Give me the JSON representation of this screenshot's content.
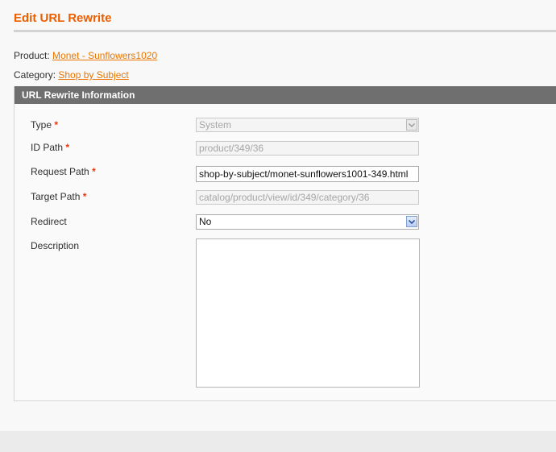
{
  "page": {
    "title": "Edit URL Rewrite"
  },
  "meta": {
    "product_label": "Product:",
    "product_link": "Monet - Sunflowers1020",
    "category_label": "Category:",
    "category_link": "Shop by Subject"
  },
  "fieldset": {
    "title": "URL Rewrite Information",
    "required_marker": "*",
    "fields": {
      "type": {
        "label": "Type",
        "value": "System",
        "disabled": true
      },
      "id_path": {
        "label": "ID Path",
        "value": "product/349/36",
        "disabled": true
      },
      "request_path": {
        "label": "Request Path",
        "value": "shop-by-subject/monet-sunflowers1001-349.html",
        "disabled": false
      },
      "target_path": {
        "label": "Target Path",
        "value": "catalog/product/view/id/349/category/36",
        "disabled": true
      },
      "redirect": {
        "label": "Redirect",
        "value": "No",
        "disabled": false
      },
      "description": {
        "label": "Description",
        "value": ""
      }
    }
  },
  "icons": {
    "type_select_arrow": "chevron-down-icon",
    "redirect_select_arrow": "chevron-down-icon"
  },
  "colors": {
    "title": "#eb5e00",
    "link": "#ea7601",
    "header_bg": "#6f6f6f",
    "required": "#eb340a"
  }
}
